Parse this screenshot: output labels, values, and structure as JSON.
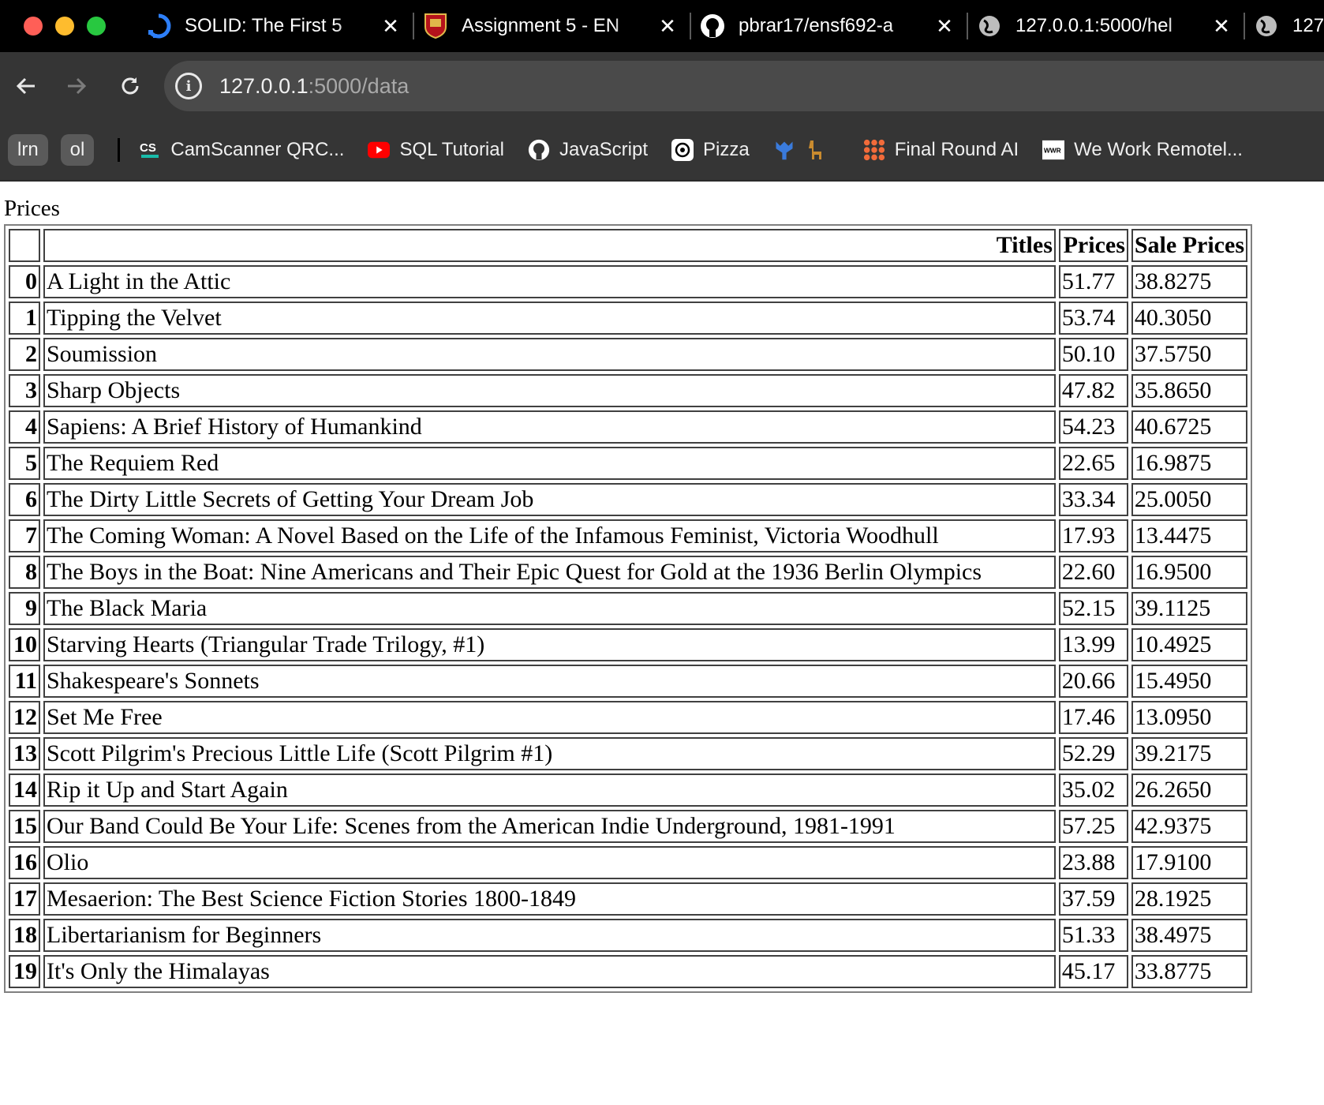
{
  "browser": {
    "tabs": [
      {
        "title": "SOLID: The First 5",
        "icon": "solid-icon"
      },
      {
        "title": "Assignment 5 - EN",
        "icon": "university-crest-icon"
      },
      {
        "title": "pbrar17/ensf692-a",
        "icon": "github-icon"
      },
      {
        "title": "127.0.0.1:5000/hel",
        "icon": "globe-icon"
      },
      {
        "title": "127",
        "icon": "globe-icon"
      }
    ],
    "address": {
      "host": "127.0.0.1",
      "path": ":5000/data"
    },
    "bookmarks": {
      "chips": [
        "lrn",
        "ol"
      ],
      "items": [
        {
          "label": "CamScanner QRC...",
          "icon": "camscanner-icon"
        },
        {
          "label": "SQL Tutorial",
          "icon": "youtube-icon"
        },
        {
          "label": "JavaScript",
          "icon": "github-icon"
        },
        {
          "label": "Pizza",
          "icon": "openai-icon"
        },
        {
          "label": "",
          "icon": "giraffe-icon"
        },
        {
          "label": "Final Round AI",
          "icon": "final-round-icon"
        },
        {
          "label": "We Work Remotel...",
          "icon": "wwr-icon"
        }
      ]
    }
  },
  "page": {
    "caption": "Prices",
    "columns": [
      "",
      "Titles",
      "Prices",
      "Sale Prices"
    ],
    "rows": [
      {
        "index": "0",
        "title": "A Light in the Attic",
        "price": "51.77",
        "sale": "38.8275"
      },
      {
        "index": "1",
        "title": "Tipping the Velvet",
        "price": "53.74",
        "sale": "40.3050"
      },
      {
        "index": "2",
        "title": "Soumission",
        "price": "50.10",
        "sale": "37.5750"
      },
      {
        "index": "3",
        "title": "Sharp Objects",
        "price": "47.82",
        "sale": "35.8650"
      },
      {
        "index": "4",
        "title": "Sapiens: A Brief History of Humankind",
        "price": "54.23",
        "sale": "40.6725"
      },
      {
        "index": "5",
        "title": "The Requiem Red",
        "price": "22.65",
        "sale": "16.9875"
      },
      {
        "index": "6",
        "title": "The Dirty Little Secrets of Getting Your Dream Job",
        "price": "33.34",
        "sale": "25.0050"
      },
      {
        "index": "7",
        "title": "The Coming Woman: A Novel Based on the Life of the Infamous Feminist, Victoria Woodhull",
        "price": "17.93",
        "sale": "13.4475"
      },
      {
        "index": "8",
        "title": "The Boys in the Boat: Nine Americans and Their Epic Quest for Gold at the 1936 Berlin Olympics",
        "price": "22.60",
        "sale": "16.9500"
      },
      {
        "index": "9",
        "title": "The Black Maria",
        "price": "52.15",
        "sale": "39.1125"
      },
      {
        "index": "10",
        "title": "Starving Hearts (Triangular Trade Trilogy, #1)",
        "price": "13.99",
        "sale": "10.4925"
      },
      {
        "index": "11",
        "title": "Shakespeare's Sonnets",
        "price": "20.66",
        "sale": "15.4950"
      },
      {
        "index": "12",
        "title": "Set Me Free",
        "price": "17.46",
        "sale": "13.0950"
      },
      {
        "index": "13",
        "title": "Scott Pilgrim's Precious Little Life (Scott Pilgrim #1)",
        "price": "52.29",
        "sale": "39.2175"
      },
      {
        "index": "14",
        "title": "Rip it Up and Start Again",
        "price": "35.02",
        "sale": "26.2650"
      },
      {
        "index": "15",
        "title": "Our Band Could Be Your Life: Scenes from the American Indie Underground, 1981-1991",
        "price": "57.25",
        "sale": "42.9375"
      },
      {
        "index": "16",
        "title": "Olio",
        "price": "23.88",
        "sale": "17.9100"
      },
      {
        "index": "17",
        "title": "Mesaerion: The Best Science Fiction Stories 1800-1849",
        "price": "37.59",
        "sale": "28.1925"
      },
      {
        "index": "18",
        "title": "Libertarianism for Beginners",
        "price": "51.33",
        "sale": "38.4975"
      },
      {
        "index": "19",
        "title": "It's Only the Himalayas",
        "price": "45.17",
        "sale": "33.8775"
      }
    ]
  }
}
